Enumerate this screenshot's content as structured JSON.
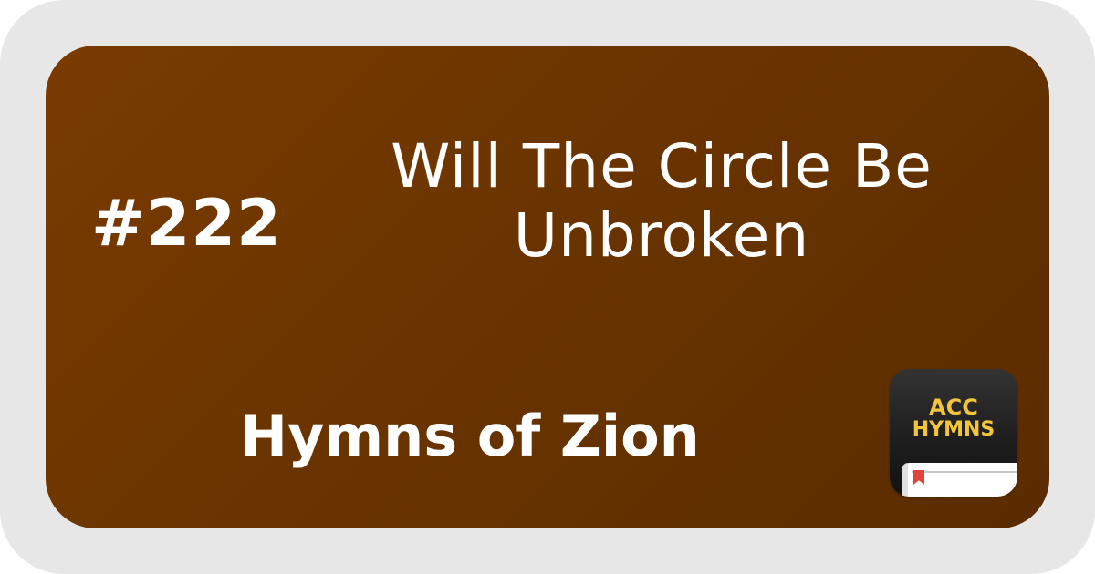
{
  "hymn": {
    "number": "#222",
    "title_line1": "Will The Circle Be",
    "title_line2": "Unbroken",
    "collection": "Hymns of Zion"
  },
  "app_icon": {
    "line1": "ACC",
    "line2": "HYMNS",
    "icon": "book-icon"
  },
  "colors": {
    "card_background_start": "#7a3b00",
    "card_background_end": "#5a2c00",
    "frame_background": "#e7e7e7",
    "text": "#ffffff",
    "icon_label": "#f2c53d",
    "bookmark": "#e0443c"
  }
}
